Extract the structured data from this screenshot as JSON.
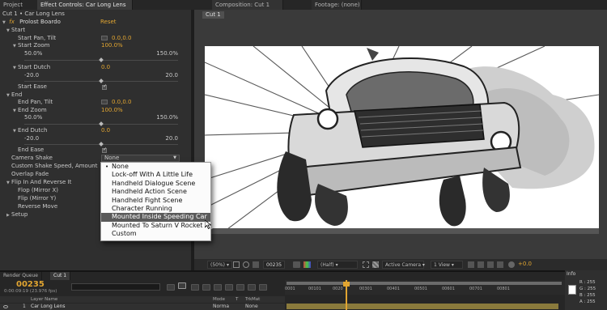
{
  "tabs_top": {
    "project": "Project",
    "effect_controls": "Effect Controls: Car Long Lens",
    "composition": "Composition: Cut 1",
    "footage": "Footage: (none)"
  },
  "effect_panel": {
    "header": "Cut 1 • Car Long Lens",
    "fx_label": "fx",
    "effect_name": "Prolost Boardo",
    "reset": "Reset",
    "rows": [
      {
        "label": "Start",
        "value": ""
      },
      {
        "label": "Start Pan, Tilt",
        "value": "0.0,0.0"
      },
      {
        "label": "Start Zoom",
        "value": "100.0%"
      },
      {
        "label": "50.0%",
        "value": "150.0%"
      },
      {
        "label": "Start Dutch",
        "value": "0.0"
      },
      {
        "label": "-20.0",
        "value": "20.0"
      },
      {
        "label": "Start Ease",
        "value": ""
      },
      {
        "label": "End",
        "value": ""
      },
      {
        "label": "End Pan, Tilt",
        "value": "0.0,0.0"
      },
      {
        "label": "End Zoom",
        "value": "100.0%"
      },
      {
        "label": "50.0%",
        "value": "150.0%"
      },
      {
        "label": "End Dutch",
        "value": "0.0"
      },
      {
        "label": "-20.0",
        "value": "20.0"
      },
      {
        "label": "End Ease",
        "value": ""
      },
      {
        "label": "Camera Shake",
        "value": "None"
      },
      {
        "label": "Custom Shake Speed, Amount",
        "value": ""
      },
      {
        "label": "Overlap Fade",
        "value": ""
      },
      {
        "label": "Flip In And Reverse It",
        "value": ""
      },
      {
        "label": "Flop (Mirror X)",
        "value": ""
      },
      {
        "label": "Flip (Mirror Y)",
        "value": ""
      },
      {
        "label": "Reverse Move",
        "value": ""
      },
      {
        "label": "Setup",
        "value": ""
      }
    ]
  },
  "camera_shake_menu": {
    "items": [
      "None",
      "Lock-off With A Little Life",
      "Handheld Dialogue Scene",
      "Handheld Action Scene",
      "Handheld Fight Scene",
      "Character Running",
      "Mounted Inside Speeding Car",
      "Mounted To Saturn V Rocket",
      "Custom"
    ],
    "checked_item": "None",
    "highlighted_item": "Mounted Inside Speeding Car"
  },
  "composition": {
    "cut_tab": "Cut 1",
    "zoom": "(50%)",
    "timecode": "00235",
    "resolution": "(Half)",
    "camera": "Active Camera",
    "views": "1 View",
    "exposure": "+0.0"
  },
  "timeline": {
    "tabs": [
      "Render Queue",
      "Cut 1"
    ],
    "current_frame": "00235",
    "timecode_sub": "0:00:09:19 (23.976 fps)",
    "ruler": [
      "0001",
      "00101",
      "0020",
      "00301",
      "00401",
      "00501",
      "00601",
      "00701",
      "00801"
    ],
    "col_layer_name": "Layer Name",
    "col_mode": "Mode",
    "col_t": "T",
    "col_trkmat": "TrkMat",
    "layer_num": "1",
    "layer_name": "Car Long Lens",
    "layer_mode": "Norma",
    "layer_trkmat": "None"
  },
  "info_panel": {
    "title": "Info",
    "r": "R : 255",
    "g": "G : 255",
    "b": "B : 255",
    "a": "A : 255"
  },
  "colors": {
    "accent": "#e1a531",
    "panel": "#2f2f2f",
    "menu_highlight": "#5a5a5a"
  }
}
